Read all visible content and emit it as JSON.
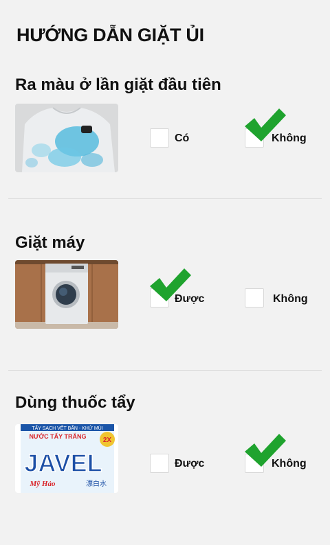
{
  "title": "HƯỚNG DẪN GIẶT ỦI",
  "sections": [
    {
      "heading": "Ra màu ở lần giặt đầu tiên",
      "image_label": "shirt-with-dye-stain",
      "options": [
        {
          "label": "Có",
          "checked": false
        },
        {
          "label": "Không",
          "checked": true
        }
      ]
    },
    {
      "heading": "Giặt máy",
      "image_label": "washing-machine",
      "options": [
        {
          "label": "Được",
          "checked": true
        },
        {
          "label": "Không",
          "checked": false
        }
      ]
    },
    {
      "heading": "Dùng thuốc tẩy",
      "image_label": "javel-bleach-package",
      "package_text": {
        "top": "TẨY SẠCH VẾT BẨN - KHỬ MÙI",
        "line1": "NƯỚC TẨY TRẮNG",
        "brand": "JAVEL",
        "maker": "Mỹ Hảo",
        "badge": "2X",
        "chinese": "漂白水"
      },
      "options": [
        {
          "label": "Được",
          "checked": false
        },
        {
          "label": "Không",
          "checked": true
        }
      ]
    }
  ],
  "colors": {
    "background": "#f2f2f2",
    "check": "#1fa32e"
  }
}
